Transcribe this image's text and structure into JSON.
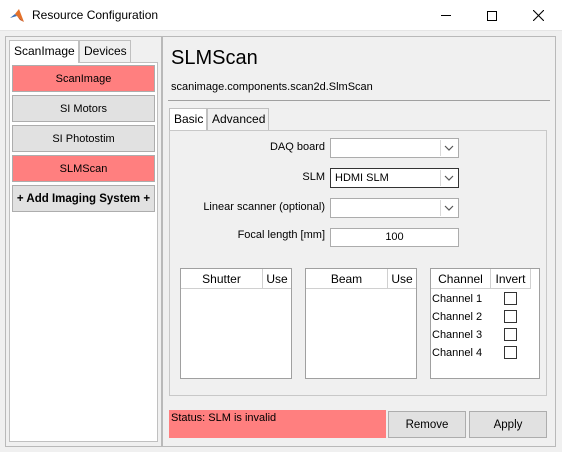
{
  "window": {
    "title": "Resource Configuration",
    "icon": "matlab-icon"
  },
  "left": {
    "tabs": [
      {
        "label": "ScanImage",
        "active": true
      },
      {
        "label": "Devices",
        "active": false
      }
    ],
    "systems": [
      {
        "label": "ScanImage",
        "highlighted": true
      },
      {
        "label": "SI Motors",
        "highlighted": false
      },
      {
        "label": "SI Photostim",
        "highlighted": false
      },
      {
        "label": "SLMScan",
        "highlighted": true
      }
    ],
    "add_label": "+ Add Imaging System +"
  },
  "main": {
    "title": "SLMScan",
    "subtitle": "scanimage.components.scan2d.SlmScan",
    "tabs": [
      {
        "label": "Basic",
        "active": true
      },
      {
        "label": "Advanced",
        "active": false
      }
    ],
    "form": {
      "daq_label": "DAQ board",
      "daq_value": "",
      "slm_label": "SLM",
      "slm_value": "HDMI SLM",
      "linscan_label": "Linear scanner (optional)",
      "linscan_value": "",
      "focal_label": "Focal length [mm]",
      "focal_value": "100"
    },
    "shutter_table": {
      "col1": "Shutter",
      "col2": "Use"
    },
    "beam_table": {
      "col1": "Beam",
      "col2": "Use"
    },
    "channel_table": {
      "col1": "Channel",
      "col2": "Invert",
      "rows": [
        {
          "name": "Channel 1",
          "invert": false
        },
        {
          "name": "Channel 2",
          "invert": false
        },
        {
          "name": "Channel 3",
          "invert": false
        },
        {
          "name": "Channel 4",
          "invert": false
        }
      ]
    },
    "status": "Status: SLM is invalid",
    "remove_label": "Remove",
    "apply_label": "Apply"
  },
  "colors": {
    "highlight": "#ff7f7f",
    "button_face": "#e1e1e1"
  }
}
